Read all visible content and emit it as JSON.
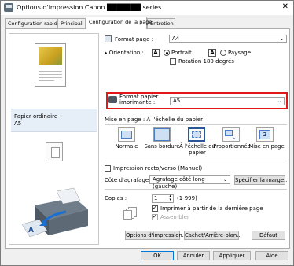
{
  "window": {
    "title": "Options d'impression Canon ███████ series",
    "close_glyph": "✕"
  },
  "tabs": [
    {
      "label": "Configuration rapide"
    },
    {
      "label": "Principal"
    },
    {
      "label": "Configuration de la page"
    },
    {
      "label": "Entretien"
    }
  ],
  "preview": {
    "media_type": "Papier ordinaire",
    "media_size": "A5"
  },
  "page_size": {
    "label": "Format page :",
    "value": "A4"
  },
  "orientation": {
    "label": "Orientation :",
    "portrait": "Portrait",
    "landscape": "Paysage",
    "portrait_icon": "A",
    "landscape_icon": "A",
    "rotate_label": "Rotation 180 degrés"
  },
  "printer_paper_size": {
    "label_line1": "Format papier",
    "label_line2": "imprimante :",
    "value": "A5"
  },
  "page_layout": {
    "label": "Mise en page :",
    "current": "À l'échelle du papier",
    "options": [
      {
        "label": "Normale"
      },
      {
        "label": "Sans bordure"
      },
      {
        "label_line1": "À l'échelle du",
        "label_line2": "papier"
      },
      {
        "label": "Proportionnée"
      },
      {
        "label": "Mise en page",
        "icon_text": "2"
      }
    ]
  },
  "duplex": {
    "label": "Impression recto/verso (Manuel)"
  },
  "stapling": {
    "label": "Côté d'agrafage :",
    "value": "Agrafage côté long (gauche)",
    "margin_button": "Spécifier la marge..."
  },
  "copies": {
    "label": "Copies :",
    "value": "1",
    "range": "(1-999)",
    "last_page_first": "Imprimer à partir de la dernière page",
    "collate": "Assembler"
  },
  "buttons": {
    "print_options": "Options d'impression...",
    "stamp": "Cachet/Arrière-plan...",
    "defaults": "Défaut",
    "ok": "OK",
    "cancel": "Annuler",
    "apply": "Appliquer",
    "help": "Aide"
  },
  "colors": {
    "highlight": "#e01818",
    "selected_tab": "#ffffff",
    "accent": "#0078d7"
  }
}
